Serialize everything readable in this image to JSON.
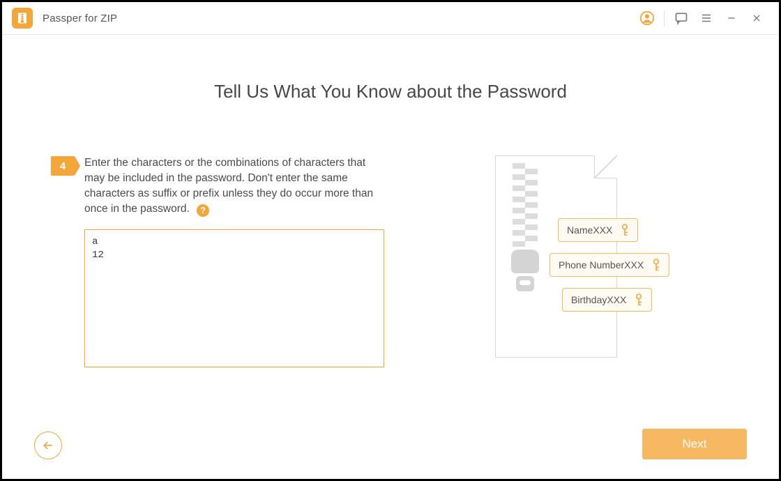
{
  "app": {
    "title": "Passper for ZIP"
  },
  "page": {
    "title": "Tell Us What You Know about the Password",
    "step_number": "4",
    "instruction": "Enter the characters or the combinations of characters that may be included in the password. Don't enter the same characters as suffix or prefix unless they do occur more than once in the password.",
    "input_value": "a\n12",
    "help_symbol": "?"
  },
  "illustration": {
    "tags": [
      "NameXXX",
      "Phone NumberXXX",
      "BirthdayXXX"
    ]
  },
  "nav": {
    "next_label": "Next"
  }
}
